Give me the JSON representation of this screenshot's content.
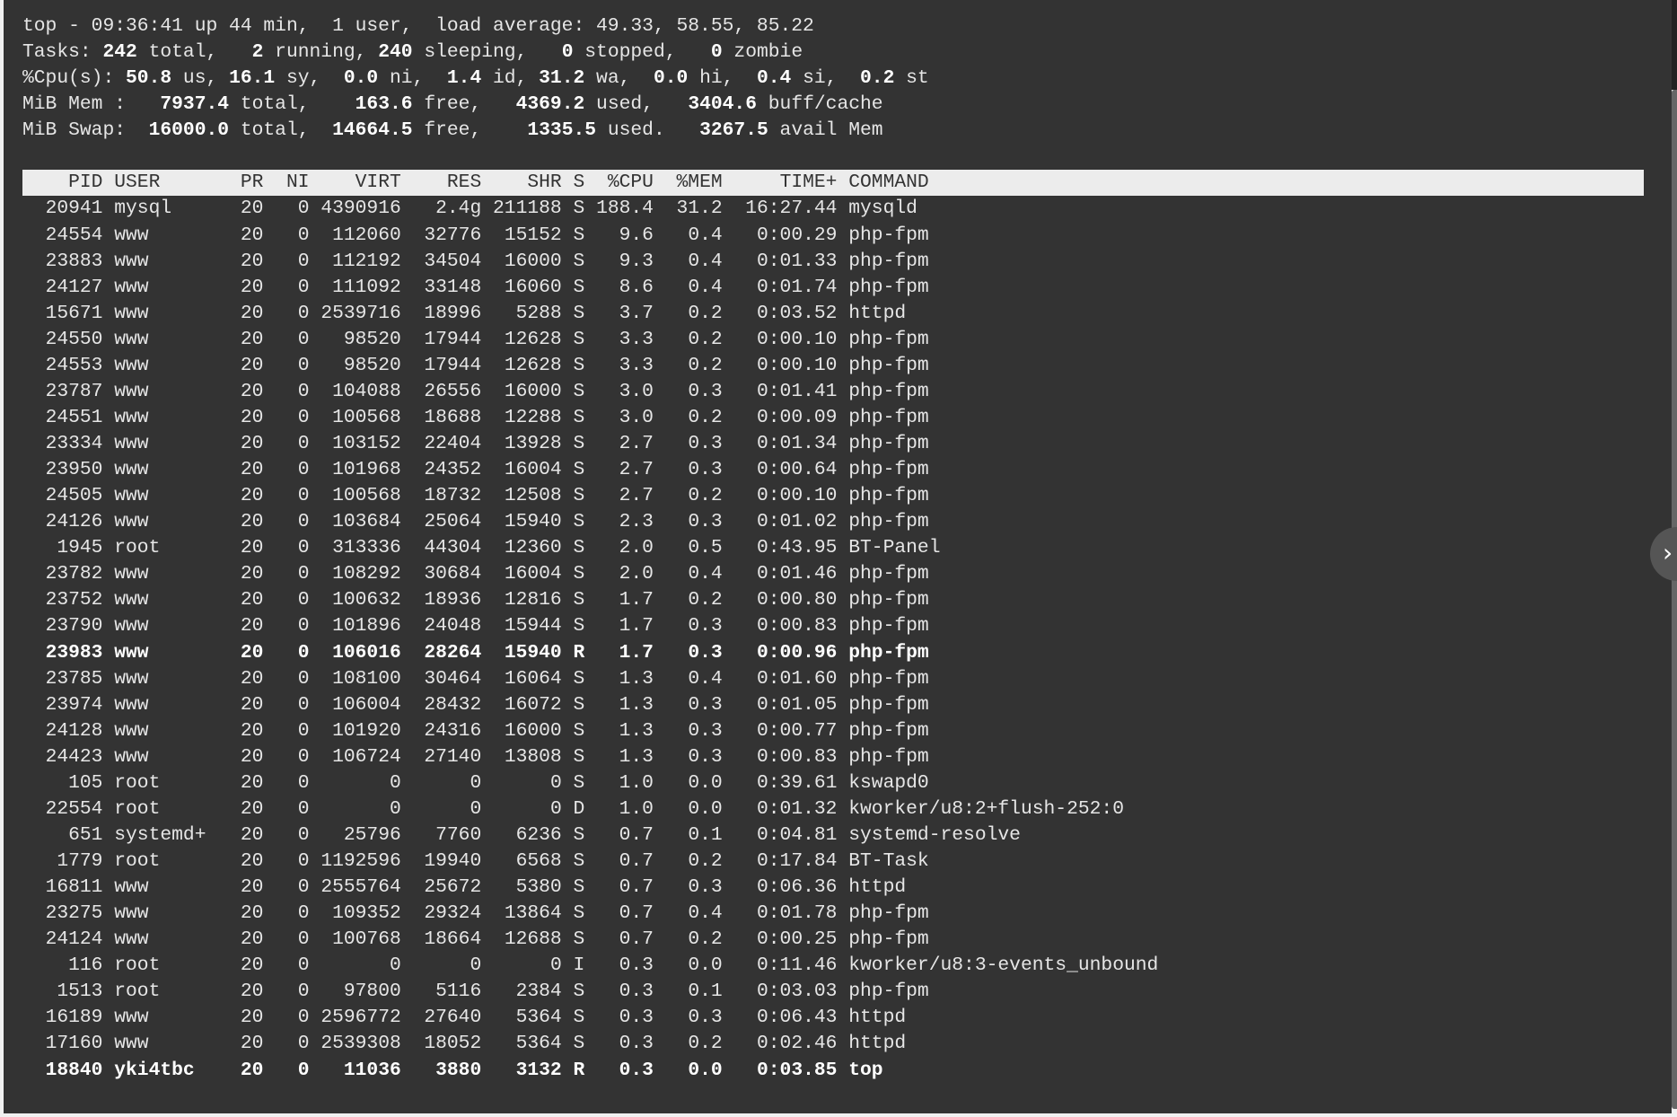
{
  "summary": [
    [
      {
        "t": "top - 09:36:41 up 44 min,  1 user,  load average: 49.33, 58.55, 85.22",
        "b": false
      }
    ],
    [
      {
        "t": "Tasks: ",
        "b": false
      },
      {
        "t": "242",
        "b": true
      },
      {
        "t": " total,   ",
        "b": false
      },
      {
        "t": "2",
        "b": true
      },
      {
        "t": " running, ",
        "b": false
      },
      {
        "t": "240",
        "b": true
      },
      {
        "t": " sleeping,   ",
        "b": false
      },
      {
        "t": "0",
        "b": true
      },
      {
        "t": " stopped,   ",
        "b": false
      },
      {
        "t": "0",
        "b": true
      },
      {
        "t": " zombie",
        "b": false
      }
    ],
    [
      {
        "t": "%Cpu(s): ",
        "b": false
      },
      {
        "t": "50.8",
        "b": true
      },
      {
        "t": " us, ",
        "b": false
      },
      {
        "t": "16.1",
        "b": true
      },
      {
        "t": " sy,  ",
        "b": false
      },
      {
        "t": "0.0",
        "b": true
      },
      {
        "t": " ni,  ",
        "b": false
      },
      {
        "t": "1.4",
        "b": true
      },
      {
        "t": " id, ",
        "b": false
      },
      {
        "t": "31.2",
        "b": true
      },
      {
        "t": " wa,  ",
        "b": false
      },
      {
        "t": "0.0",
        "b": true
      },
      {
        "t": " hi,  ",
        "b": false
      },
      {
        "t": "0.4",
        "b": true
      },
      {
        "t": " si,  ",
        "b": false
      },
      {
        "t": "0.2",
        "b": true
      },
      {
        "t": " st",
        "b": false
      }
    ],
    [
      {
        "t": "MiB Mem :   ",
        "b": false
      },
      {
        "t": "7937.4",
        "b": true
      },
      {
        "t": " total,    ",
        "b": false
      },
      {
        "t": "163.6",
        "b": true
      },
      {
        "t": " free,   ",
        "b": false
      },
      {
        "t": "4369.2",
        "b": true
      },
      {
        "t": " used,   ",
        "b": false
      },
      {
        "t": "3404.6",
        "b": true
      },
      {
        "t": " buff/cache",
        "b": false
      }
    ],
    [
      {
        "t": "MiB Swap:  ",
        "b": false
      },
      {
        "t": "16000.0",
        "b": true
      },
      {
        "t": " total,  ",
        "b": false
      },
      {
        "t": "14664.5",
        "b": true
      },
      {
        "t": " free,    ",
        "b": false
      },
      {
        "t": "1335.5",
        "b": true
      },
      {
        "t": " used.   ",
        "b": false
      },
      {
        "t": "3267.5",
        "b": true
      },
      {
        "t": " avail Mem",
        "b": false
      }
    ]
  ],
  "columns": [
    "PID",
    "USER",
    "PR",
    "NI",
    "VIRT",
    "RES",
    "SHR",
    "S",
    "%CPU",
    "%MEM",
    "TIME+",
    "COMMAND"
  ],
  "processes": [
    {
      "pid": "20941",
      "user": "mysql",
      "pr": "20",
      "ni": "0",
      "virt": "4390916",
      "res": "2.4g",
      "shr": "211188",
      "s": "S",
      "cpu": "188.4",
      "mem": "31.2",
      "time": "16:27.44",
      "cmd": "mysqld"
    },
    {
      "pid": "24554",
      "user": "www",
      "pr": "20",
      "ni": "0",
      "virt": "112060",
      "res": "32776",
      "shr": "15152",
      "s": "S",
      "cpu": "9.6",
      "mem": "0.4",
      "time": "0:00.29",
      "cmd": "php-fpm"
    },
    {
      "pid": "23883",
      "user": "www",
      "pr": "20",
      "ni": "0",
      "virt": "112192",
      "res": "34504",
      "shr": "16000",
      "s": "S",
      "cpu": "9.3",
      "mem": "0.4",
      "time": "0:01.33",
      "cmd": "php-fpm"
    },
    {
      "pid": "24127",
      "user": "www",
      "pr": "20",
      "ni": "0",
      "virt": "111092",
      "res": "33148",
      "shr": "16060",
      "s": "S",
      "cpu": "8.6",
      "mem": "0.4",
      "time": "0:01.74",
      "cmd": "php-fpm"
    },
    {
      "pid": "15671",
      "user": "www",
      "pr": "20",
      "ni": "0",
      "virt": "2539716",
      "res": "18996",
      "shr": "5288",
      "s": "S",
      "cpu": "3.7",
      "mem": "0.2",
      "time": "0:03.52",
      "cmd": "httpd"
    },
    {
      "pid": "24550",
      "user": "www",
      "pr": "20",
      "ni": "0",
      "virt": "98520",
      "res": "17944",
      "shr": "12628",
      "s": "S",
      "cpu": "3.3",
      "mem": "0.2",
      "time": "0:00.10",
      "cmd": "php-fpm"
    },
    {
      "pid": "24553",
      "user": "www",
      "pr": "20",
      "ni": "0",
      "virt": "98520",
      "res": "17944",
      "shr": "12628",
      "s": "S",
      "cpu": "3.3",
      "mem": "0.2",
      "time": "0:00.10",
      "cmd": "php-fpm"
    },
    {
      "pid": "23787",
      "user": "www",
      "pr": "20",
      "ni": "0",
      "virt": "104088",
      "res": "26556",
      "shr": "16000",
      "s": "S",
      "cpu": "3.0",
      "mem": "0.3",
      "time": "0:01.41",
      "cmd": "php-fpm"
    },
    {
      "pid": "24551",
      "user": "www",
      "pr": "20",
      "ni": "0",
      "virt": "100568",
      "res": "18688",
      "shr": "12288",
      "s": "S",
      "cpu": "3.0",
      "mem": "0.2",
      "time": "0:00.09",
      "cmd": "php-fpm"
    },
    {
      "pid": "23334",
      "user": "www",
      "pr": "20",
      "ni": "0",
      "virt": "103152",
      "res": "22404",
      "shr": "13928",
      "s": "S",
      "cpu": "2.7",
      "mem": "0.3",
      "time": "0:01.34",
      "cmd": "php-fpm"
    },
    {
      "pid": "23950",
      "user": "www",
      "pr": "20",
      "ni": "0",
      "virt": "101968",
      "res": "24352",
      "shr": "16004",
      "s": "S",
      "cpu": "2.7",
      "mem": "0.3",
      "time": "0:00.64",
      "cmd": "php-fpm"
    },
    {
      "pid": "24505",
      "user": "www",
      "pr": "20",
      "ni": "0",
      "virt": "100568",
      "res": "18732",
      "shr": "12508",
      "s": "S",
      "cpu": "2.7",
      "mem": "0.2",
      "time": "0:00.10",
      "cmd": "php-fpm"
    },
    {
      "pid": "24126",
      "user": "www",
      "pr": "20",
      "ni": "0",
      "virt": "103684",
      "res": "25064",
      "shr": "15940",
      "s": "S",
      "cpu": "2.3",
      "mem": "0.3",
      "time": "0:01.02",
      "cmd": "php-fpm"
    },
    {
      "pid": "1945",
      "user": "root",
      "pr": "20",
      "ni": "0",
      "virt": "313336",
      "res": "44304",
      "shr": "12360",
      "s": "S",
      "cpu": "2.0",
      "mem": "0.5",
      "time": "0:43.95",
      "cmd": "BT-Panel"
    },
    {
      "pid": "23782",
      "user": "www",
      "pr": "20",
      "ni": "0",
      "virt": "108292",
      "res": "30684",
      "shr": "16004",
      "s": "S",
      "cpu": "2.0",
      "mem": "0.4",
      "time": "0:01.46",
      "cmd": "php-fpm"
    },
    {
      "pid": "23752",
      "user": "www",
      "pr": "20",
      "ni": "0",
      "virt": "100632",
      "res": "18936",
      "shr": "12816",
      "s": "S",
      "cpu": "1.7",
      "mem": "0.2",
      "time": "0:00.80",
      "cmd": "php-fpm"
    },
    {
      "pid": "23790",
      "user": "www",
      "pr": "20",
      "ni": "0",
      "virt": "101896",
      "res": "24048",
      "shr": "15944",
      "s": "S",
      "cpu": "1.7",
      "mem": "0.3",
      "time": "0:00.83",
      "cmd": "php-fpm"
    },
    {
      "pid": "23983",
      "user": "www",
      "pr": "20",
      "ni": "0",
      "virt": "106016",
      "res": "28264",
      "shr": "15940",
      "s": "R",
      "cpu": "1.7",
      "mem": "0.3",
      "time": "0:00.96",
      "cmd": "php-fpm",
      "bold": true
    },
    {
      "pid": "23785",
      "user": "www",
      "pr": "20",
      "ni": "0",
      "virt": "108100",
      "res": "30464",
      "shr": "16064",
      "s": "S",
      "cpu": "1.3",
      "mem": "0.4",
      "time": "0:01.60",
      "cmd": "php-fpm"
    },
    {
      "pid": "23974",
      "user": "www",
      "pr": "20",
      "ni": "0",
      "virt": "106004",
      "res": "28432",
      "shr": "16072",
      "s": "S",
      "cpu": "1.3",
      "mem": "0.3",
      "time": "0:01.05",
      "cmd": "php-fpm"
    },
    {
      "pid": "24128",
      "user": "www",
      "pr": "20",
      "ni": "0",
      "virt": "101920",
      "res": "24316",
      "shr": "16000",
      "s": "S",
      "cpu": "1.3",
      "mem": "0.3",
      "time": "0:00.77",
      "cmd": "php-fpm"
    },
    {
      "pid": "24423",
      "user": "www",
      "pr": "20",
      "ni": "0",
      "virt": "106724",
      "res": "27140",
      "shr": "13808",
      "s": "S",
      "cpu": "1.3",
      "mem": "0.3",
      "time": "0:00.83",
      "cmd": "php-fpm"
    },
    {
      "pid": "105",
      "user": "root",
      "pr": "20",
      "ni": "0",
      "virt": "0",
      "res": "0",
      "shr": "0",
      "s": "S",
      "cpu": "1.0",
      "mem": "0.0",
      "time": "0:39.61",
      "cmd": "kswapd0"
    },
    {
      "pid": "22554",
      "user": "root",
      "pr": "20",
      "ni": "0",
      "virt": "0",
      "res": "0",
      "shr": "0",
      "s": "D",
      "cpu": "1.0",
      "mem": "0.0",
      "time": "0:01.32",
      "cmd": "kworker/u8:2+flush-252:0"
    },
    {
      "pid": "651",
      "user": "systemd+",
      "pr": "20",
      "ni": "0",
      "virt": "25796",
      "res": "7760",
      "shr": "6236",
      "s": "S",
      "cpu": "0.7",
      "mem": "0.1",
      "time": "0:04.81",
      "cmd": "systemd-resolve"
    },
    {
      "pid": "1779",
      "user": "root",
      "pr": "20",
      "ni": "0",
      "virt": "1192596",
      "res": "19940",
      "shr": "6568",
      "s": "S",
      "cpu": "0.7",
      "mem": "0.2",
      "time": "0:17.84",
      "cmd": "BT-Task"
    },
    {
      "pid": "16811",
      "user": "www",
      "pr": "20",
      "ni": "0",
      "virt": "2555764",
      "res": "25672",
      "shr": "5380",
      "s": "S",
      "cpu": "0.7",
      "mem": "0.3",
      "time": "0:06.36",
      "cmd": "httpd"
    },
    {
      "pid": "23275",
      "user": "www",
      "pr": "20",
      "ni": "0",
      "virt": "109352",
      "res": "29324",
      "shr": "13864",
      "s": "S",
      "cpu": "0.7",
      "mem": "0.4",
      "time": "0:01.78",
      "cmd": "php-fpm"
    },
    {
      "pid": "24124",
      "user": "www",
      "pr": "20",
      "ni": "0",
      "virt": "100768",
      "res": "18664",
      "shr": "12688",
      "s": "S",
      "cpu": "0.7",
      "mem": "0.2",
      "time": "0:00.25",
      "cmd": "php-fpm"
    },
    {
      "pid": "116",
      "user": "root",
      "pr": "20",
      "ni": "0",
      "virt": "0",
      "res": "0",
      "shr": "0",
      "s": "I",
      "cpu": "0.3",
      "mem": "0.0",
      "time": "0:11.46",
      "cmd": "kworker/u8:3-events_unbound"
    },
    {
      "pid": "1513",
      "user": "root",
      "pr": "20",
      "ni": "0",
      "virt": "97800",
      "res": "5116",
      "shr": "2384",
      "s": "S",
      "cpu": "0.3",
      "mem": "0.1",
      "time": "0:03.03",
      "cmd": "php-fpm"
    },
    {
      "pid": "16189",
      "user": "www",
      "pr": "20",
      "ni": "0",
      "virt": "2596772",
      "res": "27640",
      "shr": "5364",
      "s": "S",
      "cpu": "0.3",
      "mem": "0.3",
      "time": "0:06.43",
      "cmd": "httpd"
    },
    {
      "pid": "17160",
      "user": "www",
      "pr": "20",
      "ni": "0",
      "virt": "2539308",
      "res": "18052",
      "shr": "5364",
      "s": "S",
      "cpu": "0.3",
      "mem": "0.2",
      "time": "0:02.46",
      "cmd": "httpd"
    },
    {
      "pid": "18840",
      "user": "yki4tbc",
      "pr": "20",
      "ni": "0",
      "virt": "11036",
      "res": "3880",
      "shr": "3132",
      "s": "R",
      "cpu": "0.3",
      "mem": "0.0",
      "time": "0:03.85",
      "cmd": "top",
      "bold": true
    }
  ],
  "sidebar_toggle": {
    "icon": "chevron-right-icon",
    "glyph": "›"
  }
}
